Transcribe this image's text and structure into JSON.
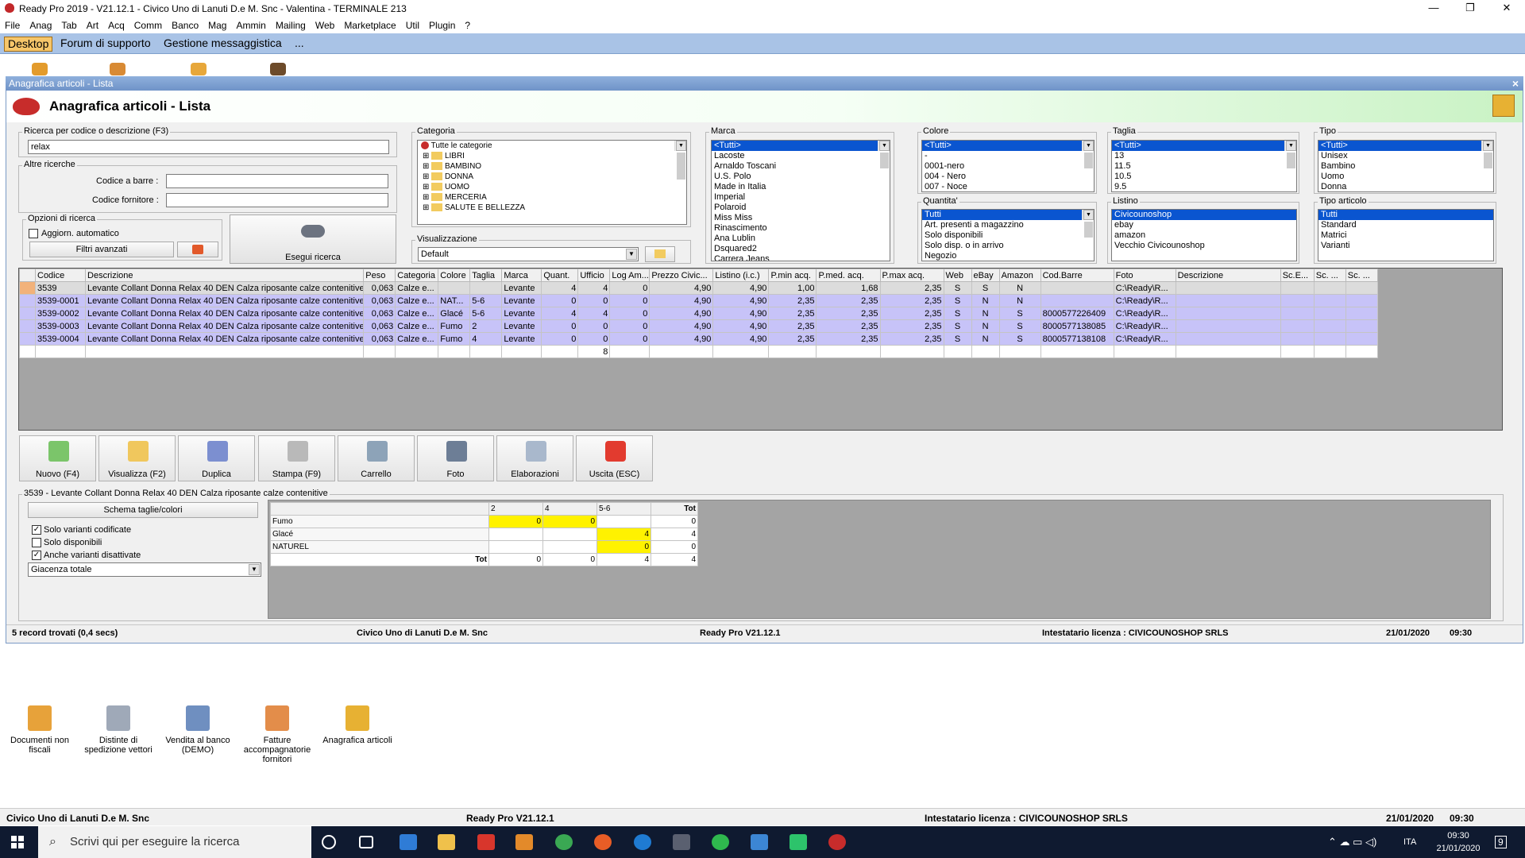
{
  "titlebar": {
    "title": "Ready Pro 2019 - V21.12.1 - Civico Uno di Lanuti D.e M. Snc - Valentina - TERMINALE 213",
    "minimize": "—",
    "restore": "❐",
    "close": "✕"
  },
  "menu": [
    "File",
    "Anag",
    "Tab",
    "Art",
    "Acq",
    "Comm",
    "Banco",
    "Mag",
    "Ammin",
    "Mailing",
    "Web",
    "Marketplace",
    "Util",
    "Plugin",
    "?"
  ],
  "tabs": [
    "Desktop",
    "Forum di supporto",
    "Gestione messaggistica",
    "..."
  ],
  "window": {
    "title": "Anagrafica articoli - Lista",
    "close": "×",
    "header": "Anagrafica articoli  - Lista"
  },
  "search": {
    "group": "Ricerca per codice o descrizione (F3)",
    "value": "relax",
    "other_group": "Altre ricerche",
    "barcode_label": "Codice a barre :",
    "barcode_value": "",
    "supplier_label": "Codice fornitore :",
    "supplier_value": "",
    "options_group": "Opzioni di ricerca",
    "auto_update": "Aggiorn. automatico",
    "advanced": "Filtri avanzati",
    "execute": "Esegui ricerca"
  },
  "categoria": {
    "label": "Categoria",
    "items": [
      "Tutte le categorie",
      "LIBRI",
      "BAMBINO",
      "DONNA",
      "UOMO",
      "MERCERIA",
      "SALUTE E BELLEZZA"
    ]
  },
  "visualizzazione": {
    "label": "Visualizzazione",
    "value": "Default"
  },
  "marca": {
    "label": "Marca",
    "items": [
      "<Tutti>",
      "Lacoste",
      "Arnaldo Toscani",
      "U.S. Polo",
      "Made in Italia",
      "Imperial",
      "Polaroid",
      "Miss Miss",
      "Rinascimento",
      "Ana Lublin",
      "Dsquared2",
      "Carrera Jeans"
    ]
  },
  "colore": {
    "label": "Colore",
    "items": [
      "<Tutti>",
      "-",
      "0001-nero",
      "004 - Nero",
      "007 - Noce"
    ]
  },
  "taglia": {
    "label": "Taglia",
    "items": [
      "<Tutti>",
      "13",
      "11.5",
      "10.5",
      "9.5"
    ]
  },
  "tipo": {
    "label": "Tipo",
    "items": [
      "<Tutti>",
      "Unisex",
      "Bambino",
      "Uomo",
      "Donna"
    ]
  },
  "quantita": {
    "label": "Quantita'",
    "items": [
      "Tutti",
      "Art. presenti a magazzino",
      "Solo disponibili",
      "Solo disp. o in arrivo",
      "Negozio"
    ]
  },
  "listino": {
    "label": "Listino",
    "items": [
      "Civicounoshop",
      "ebay",
      "amazon",
      "Vecchio Civicounoshop"
    ]
  },
  "tipo_articolo": {
    "label": "Tipo articolo",
    "items": [
      "Tutti",
      "Standard",
      "Matrici",
      "Varianti"
    ]
  },
  "table": {
    "columns": [
      "",
      "Codice",
      "Descrizione",
      "Peso",
      "Categoria",
      "Colore",
      "Taglia",
      "Marca",
      "Quant.",
      "Ufficio",
      "Log Am...",
      "Prezzo Civic...",
      "Listino (i.c.)",
      "P.min acq.",
      "P.med. acq.",
      "P.max acq.",
      "Web",
      "eBay",
      "Amazon",
      "Cod.Barre",
      "Foto",
      "Descrizione",
      "Sc.E...",
      "Sc. ...",
      "Sc. ..."
    ],
    "rows": [
      [
        "",
        "3539",
        "Levante Collant Donna Relax 40 DEN Calza riposante calze contenitive",
        "0,063",
        "Calze e...",
        "",
        "",
        "Levante",
        "4",
        "4",
        "0",
        "4,90",
        "4,90",
        "1,00",
        "1,68",
        "2,35",
        "S",
        "S",
        "N",
        "",
        "C:\\Ready\\R...",
        "",
        "",
        "",
        ""
      ],
      [
        "",
        "3539-0001",
        "Levante Collant Donna Relax 40 DEN Calza riposante calze contenitive",
        "0,063",
        "Calze e...",
        "NAT...",
        "5-6",
        "Levante",
        "0",
        "0",
        "0",
        "4,90",
        "4,90",
        "2,35",
        "2,35",
        "2,35",
        "S",
        "N",
        "N",
        "",
        "C:\\Ready\\R...",
        "",
        "",
        "",
        ""
      ],
      [
        "",
        "3539-0002",
        "Levante Collant Donna Relax 40 DEN Calza riposante calze contenitive",
        "0,063",
        "Calze e...",
        "Glacé",
        "5-6",
        "Levante",
        "4",
        "4",
        "0",
        "4,90",
        "4,90",
        "2,35",
        "2,35",
        "2,35",
        "S",
        "N",
        "S",
        "8000577226409",
        "C:\\Ready\\R...",
        "",
        "",
        "",
        ""
      ],
      [
        "",
        "3539-0003",
        "Levante Collant Donna Relax 40 DEN Calza riposante calze contenitive",
        "0,063",
        "Calze e...",
        "Fumo",
        "2",
        "Levante",
        "0",
        "0",
        "0",
        "4,90",
        "4,90",
        "2,35",
        "2,35",
        "2,35",
        "S",
        "N",
        "S",
        "8000577138085",
        "C:\\Ready\\R...",
        "",
        "",
        "",
        ""
      ],
      [
        "",
        "3539-0004",
        "Levante Collant Donna Relax 40 DEN Calza riposante calze contenitive",
        "0,063",
        "Calze e...",
        "Fumo",
        "4",
        "Levante",
        "0",
        "0",
        "0",
        "4,90",
        "4,90",
        "2,35",
        "2,35",
        "2,35",
        "S",
        "N",
        "S",
        "8000577138108",
        "C:\\Ready\\R...",
        "",
        "",
        "",
        ""
      ]
    ],
    "total": "8"
  },
  "toolbar": [
    "Nuovo (F4)",
    "Visualizza (F2)",
    "Duplica",
    "Stampa (F9)",
    "Carrello",
    "Foto",
    "Elaborazioni",
    "Uscita (ESC)"
  ],
  "variants": {
    "group": "3539 - Levante Collant Donna Relax 40 DEN Calza riposante calze contenitive",
    "schema": "Schema taglie/colori",
    "only_coded": "Solo varianti codificate",
    "only_available": "Solo disponibili",
    "also_disabled": "Anche varianti disattivate",
    "giacenza": "Giacenza totale",
    "headers": [
      "",
      "2",
      "4",
      "5-6",
      "Tot"
    ],
    "rows": [
      [
        "Fumo",
        "0",
        "0",
        "",
        "0"
      ],
      [
        "Glacé",
        "",
        "",
        "4",
        "4"
      ],
      [
        "NATUREL",
        "",
        "",
        "0",
        "0"
      ]
    ],
    "tot": [
      "Tot",
      "0",
      "0",
      "4",
      "4"
    ]
  },
  "status": {
    "records": "5 record trovati (0,4 secs)",
    "company": "Civico Uno di Lanuti D.e M. Snc",
    "version": "Ready Pro V21.12.1",
    "license": "Intestatario licenza : CIVICOUNOSHOP SRLS",
    "date": "21/01/2020",
    "time": "09:30"
  },
  "desktop_icons": [
    "Documenti non fiscali",
    "Distinte di spedizione vettori",
    "Vendita al banco (DEMO)",
    "Fatture accompagnatorie fornitori",
    "Anagrafica articoli"
  ],
  "footer": {
    "company": "Civico Uno di Lanuti D.e M. Snc",
    "version": "Ready Pro V21.12.1",
    "license": "Intestatario licenza : CIVICOUNOSHOP SRLS",
    "date": "21/01/2020",
    "time": "09:30"
  },
  "taskbar": {
    "search_placeholder": "Scrivi qui per eseguire la ricerca",
    "lang": "ITA",
    "time": "09:30",
    "date": "21/01/2020",
    "notif": "9"
  }
}
